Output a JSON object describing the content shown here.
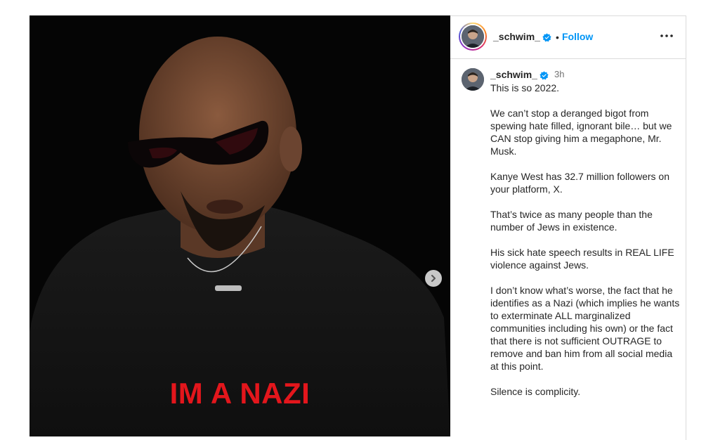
{
  "post": {
    "image_caption": "IM A NAZI",
    "next_button_icon": "chevron-right-icon"
  },
  "header": {
    "username": "_schwim_",
    "verified_icon": "verified-badge-icon",
    "separator": "•",
    "follow_label": "Follow",
    "more_icon": "more-options-icon"
  },
  "caption": {
    "username": "_schwim_",
    "verified_icon": "verified-badge-icon",
    "time": "3h",
    "paragraphs": [
      "This is so 2022.",
      "We can’t stop a deranged bigot from spewing hate filled, ignorant bile… but we CAN stop giving him a megaphone, Mr. Musk.",
      "Kanye West has 32.7 million followers on your platform, X.",
      "That’s twice as many people than the number of Jews in existence.",
      "His sick hate speech results in REAL LIFE violence against Jews.",
      "I don’t know what’s worse, the fact that he identifies as a Nazi (which implies he wants to exterminate ALL marginalized communities including his own) or the fact that there is not sufficient OUTRAGE to remove and ban him from all social media at this point.",
      "Silence is complicity."
    ]
  },
  "colors": {
    "link_blue": "#0095f6",
    "verified_blue": "#0095f6",
    "caption_red": "#e3161c"
  }
}
